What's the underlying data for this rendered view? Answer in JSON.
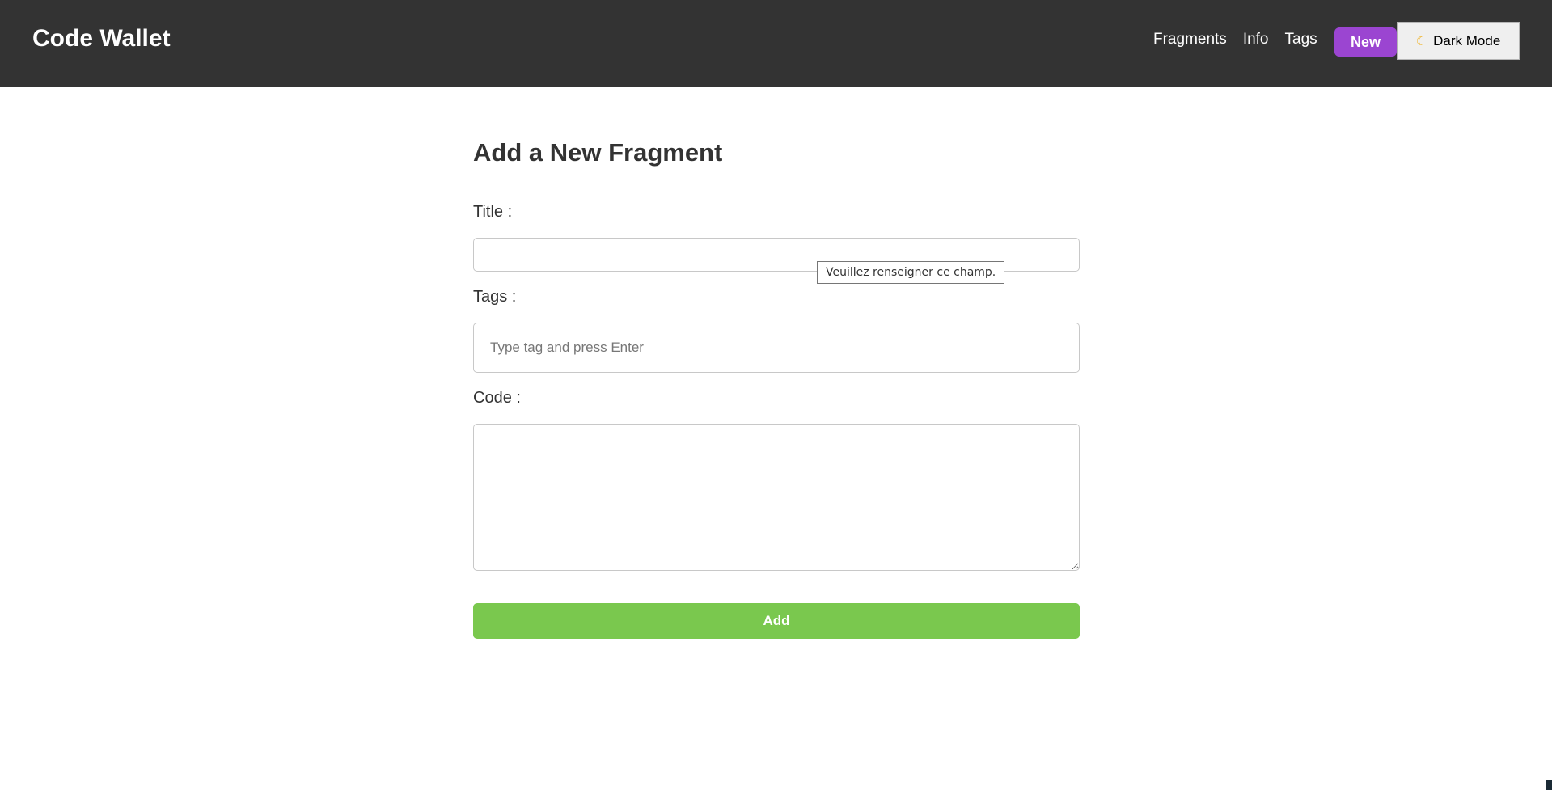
{
  "app": {
    "brand": "Code Wallet"
  },
  "nav": {
    "links": [
      "Fragments",
      "Info",
      "Tags"
    ],
    "new_label": "New",
    "dark_mode_label": "Dark Mode",
    "dark_mode_icon": "moon-icon"
  },
  "form": {
    "heading": "Add a New Fragment",
    "title_label": "Title :",
    "title_value": "",
    "tags_label": "Tags :",
    "tags_placeholder": "Type tag and press Enter",
    "code_label": "Code :",
    "code_value": "",
    "submit_label": "Add",
    "validation_tooltip": "Veuillez renseigner ce champ."
  },
  "colors": {
    "navbar": "#333333",
    "new_button": "#9b45d1",
    "add_button": "#7ac84e"
  }
}
